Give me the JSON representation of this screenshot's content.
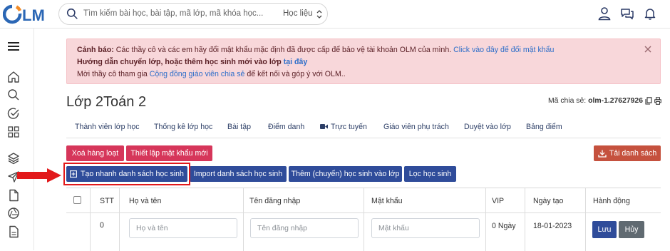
{
  "header": {
    "logo_text": "OLM",
    "search_placeholder": "Tìm kiếm bài học, bài tập, mã lớp, mã khóa học...",
    "search_scope": "Học liệu",
    "icons": [
      "user-icon",
      "chat-icon",
      "bell-icon"
    ]
  },
  "sidebar": {
    "icons": [
      "menu-icon",
      "home-icon",
      "search-icon",
      "check-circle-icon",
      "grid-icon",
      "layers-icon",
      "send-icon",
      "document-icon",
      "aperture-icon",
      "file-icon"
    ]
  },
  "alert": {
    "line1_label": "Cảnh báo:",
    "line1_text": " Các thầy cô và các em hãy đổi mật khẩu mặc định đã được cấp để bảo vệ tài khoản OLM của mình. ",
    "line1_link": "Click vào đây để đổi mật khẩu",
    "line2_text": "Hướng dẫn chuyển lớp, hoặc thêm học sinh mới vào lớp ",
    "line2_link": "tại đây",
    "line3_text": "Mời thầy cô tham gia ",
    "line3_link": "Cộng đồng giáo viên chia sẻ",
    "line3_tail": " để kết nối và góp ý với OLM.."
  },
  "page": {
    "title": "Lớp 2Toán 2",
    "share_label": "Mã chia sẻ:",
    "share_code": "olm-1.27627926"
  },
  "tabs": [
    "Thành viên lớp học",
    "Thống kê lớp học",
    "Bài tập",
    "Điểm danh",
    "Trực tuyến",
    "Giáo viên phụ trách",
    "Duyệt vào lớp",
    "Bảng điểm"
  ],
  "actions": {
    "delete_bulk": "Xoá hàng loạt",
    "set_password": "Thiết lập mật khẩu mới",
    "download_list": "Tải danh sách",
    "quick_create": "Tạo nhanh danh sách học sinh",
    "import_list": "Import danh sách học sinh",
    "add_student": "Thêm (chuyển) học sinh vào lớp",
    "filter_student": "Lọc học sinh"
  },
  "table": {
    "headers": [
      "STT",
      "Họ và tên",
      "Tên đăng nhập",
      "Mật khẩu",
      "VIP",
      "Ngày tạo",
      "Hành động"
    ],
    "row": {
      "stt": "0",
      "name_placeholder": "Họ và tên",
      "username_placeholder": "Tên đăng nhập",
      "password_placeholder": "Mật khẩu",
      "vip": "0 Ngày",
      "created": "18-01-2023",
      "save": "Lưu",
      "cancel": "Hủy"
    }
  },
  "colors": {
    "accent_red": "#d6365a",
    "accent_blue": "#2f4c9a",
    "highlight": "#e2191b",
    "logo_orange": "#f28c28",
    "logo_blue": "#2b67b5"
  }
}
